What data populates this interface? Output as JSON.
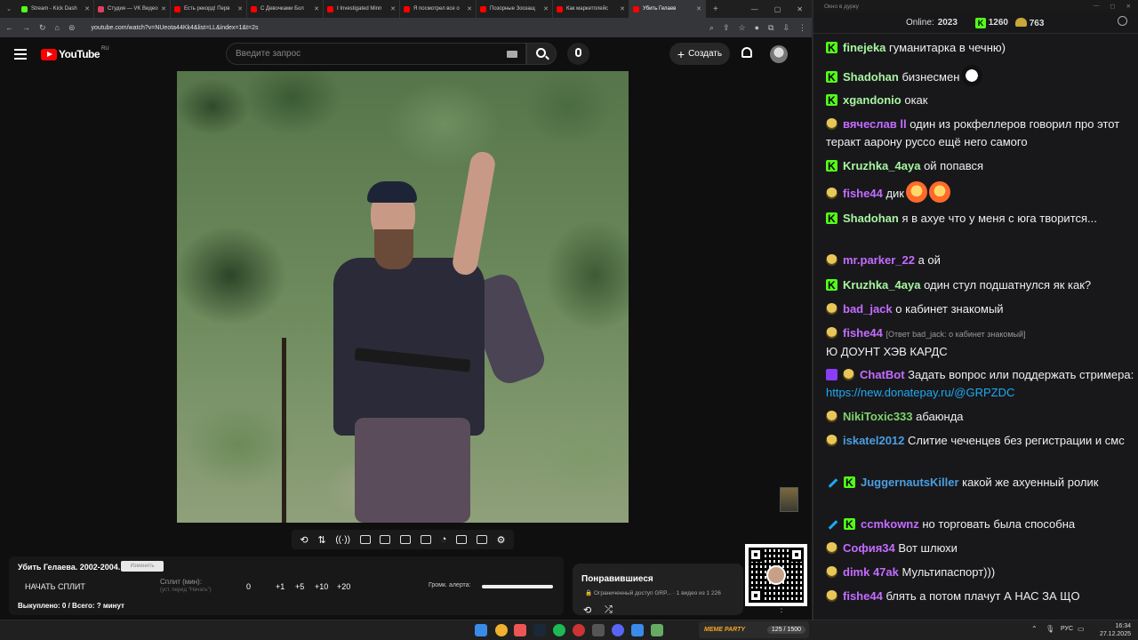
{
  "browser": {
    "tabs": [
      {
        "label": "Stream - Kick Dash",
        "color": "#53fc18"
      },
      {
        "label": "Студия — VK Видео",
        "color": "#e04060"
      },
      {
        "label": "Есть рекорд! Перв",
        "color": "#ff0000"
      },
      {
        "label": "С Девочками Бол",
        "color": "#ff0000"
      },
      {
        "label": "I Investigated Minn",
        "color": "#ff0000"
      },
      {
        "label": "Я посмотрел все о",
        "color": "#ff0000"
      },
      {
        "label": "Позорные Зоозащ",
        "color": "#ff0000"
      },
      {
        "label": "Как маркетплейс",
        "color": "#ff0000"
      },
      {
        "label": "Убить Гелаев",
        "color": "#ff0000",
        "active": true
      }
    ],
    "url": "youtube.com/watch?v=NUeota44Kk4&list=LL&index=1&t=2s"
  },
  "youtube": {
    "logo_text": "YouTube",
    "logo_region": "RU",
    "search_placeholder": "Введите запрос",
    "create_label": "Создать",
    "create_plus": "+"
  },
  "panel": {
    "title": "Убить Гелаева. 2002-2004.",
    "title_button": "Изменить",
    "start_split": "НАЧАТЬ СПЛИТ",
    "split_label": "Сплит (мин):",
    "split_hint": "(уст. перед \"Начать\")",
    "zero": "0",
    "increments": [
      "+1",
      "+5",
      "+10",
      "+20"
    ],
    "alert_label": "Громк. алерта:",
    "alert_volume": 1.0,
    "status": "Выкуплено: 0 / Всего: ? минут"
  },
  "liked": {
    "title": "Понравившиеся",
    "subtitle": "🔒 Ограниченный доступ GRP... · 1 видео из 1 226"
  },
  "chat": {
    "window_title": "Окно в дурку",
    "online_label": "Online:",
    "online_count": "2023",
    "stat_k": "1260",
    "stat_coin": "763",
    "messages": [
      {
        "badges": [
          "k"
        ],
        "user": "finejeka",
        "color": "#a8f5a0",
        "text": "гуманитарка в чечню)"
      },
      {
        "badges": [
          "k"
        ],
        "user": "Shadohan",
        "color": "#a8f5a0",
        "text": "бизнесмен",
        "emoji": [
          "face"
        ]
      },
      {
        "badges": [
          "k"
        ],
        "user": "xgandonio",
        "color": "#a8f5a0",
        "text": "окак"
      },
      {
        "badges": [
          "coin"
        ],
        "user": "вячеслав ll",
        "color": "#c46cff",
        "text": "один из рокфеллеров говорил про этот теракт аарону руссо ещё него самого"
      },
      {
        "badges": [
          "k"
        ],
        "user": "Kruzhka_4aya",
        "color": "#a8f5a0",
        "text": "ой попався"
      },
      {
        "badges": [
          "coin"
        ],
        "user": "fishe44",
        "color": "#c46cff",
        "text": "дик",
        "emoji": [
          "fire",
          "fire"
        ]
      },
      {
        "badges": [
          "k"
        ],
        "user": "Shadohan",
        "color": "#a8f5a0",
        "text": "я в ахуе что у меня с юга творится..."
      },
      {
        "badges": [
          "coin"
        ],
        "user": "mr.parker_22",
        "color": "#c46cff",
        "text": "а ой"
      },
      {
        "badges": [
          "k"
        ],
        "user": "Kruzhka_4aya",
        "color": "#a8f5a0",
        "text": "один стул подшатнулся як как?"
      },
      {
        "badges": [
          "coin"
        ],
        "user": "bad_jack",
        "color": "#c46cff",
        "text": "о кабинет знакомый"
      },
      {
        "badges": [
          "coin"
        ],
        "user": "fishe44",
        "color": "#c46cff",
        "reply": "[Ответ bad_jack: о кабинет знакомый]",
        "text": "Ю ДОУНТ ХЭВ КАРДС"
      },
      {
        "badges": [
          "bot",
          "coin"
        ],
        "user": "ChatBot",
        "color": "#c46cff",
        "text": "Задать вопрос или поддержать стримера:",
        "link": "https://new.donatepay.ru/@GRPZDC"
      },
      {
        "badges": [
          "coin"
        ],
        "user": "NikiToxic333",
        "color": "#7fd36a",
        "text": "абаюнда"
      },
      {
        "badges": [
          "coin"
        ],
        "user": "iskatel2012",
        "color": "#4a9fe0",
        "text": "Слитие чеченцев без регистрации и смс"
      },
      {
        "badges": [
          "sword",
          "k"
        ],
        "user": "JuggernautsKiller",
        "color": "#4a9fe0",
        "text": "какой же ахуенный ролик"
      },
      {
        "badges": [
          "sword",
          "k"
        ],
        "user": "ccmkownz",
        "color": "#c46cff",
        "text": "но торговать была способна"
      },
      {
        "badges": [
          "coin"
        ],
        "user": "София34",
        "color": "#c46cff",
        "text": "Вот шлюхи"
      },
      {
        "badges": [
          "coin"
        ],
        "user": "dimk 47ak",
        "color": "#c46cff",
        "text": "Мультипаспорт)))"
      },
      {
        "badges": [
          "coin"
        ],
        "user": "fishe44",
        "color": "#c46cff",
        "text": "блять а потом плачут А НАС ЗА ЩО"
      }
    ]
  },
  "taskbar": {
    "meme_label": "MEME PARTY",
    "meme_count": "125 / 1500",
    "lang": "РУС",
    "time": "16:34",
    "date": "27.12.2025"
  }
}
